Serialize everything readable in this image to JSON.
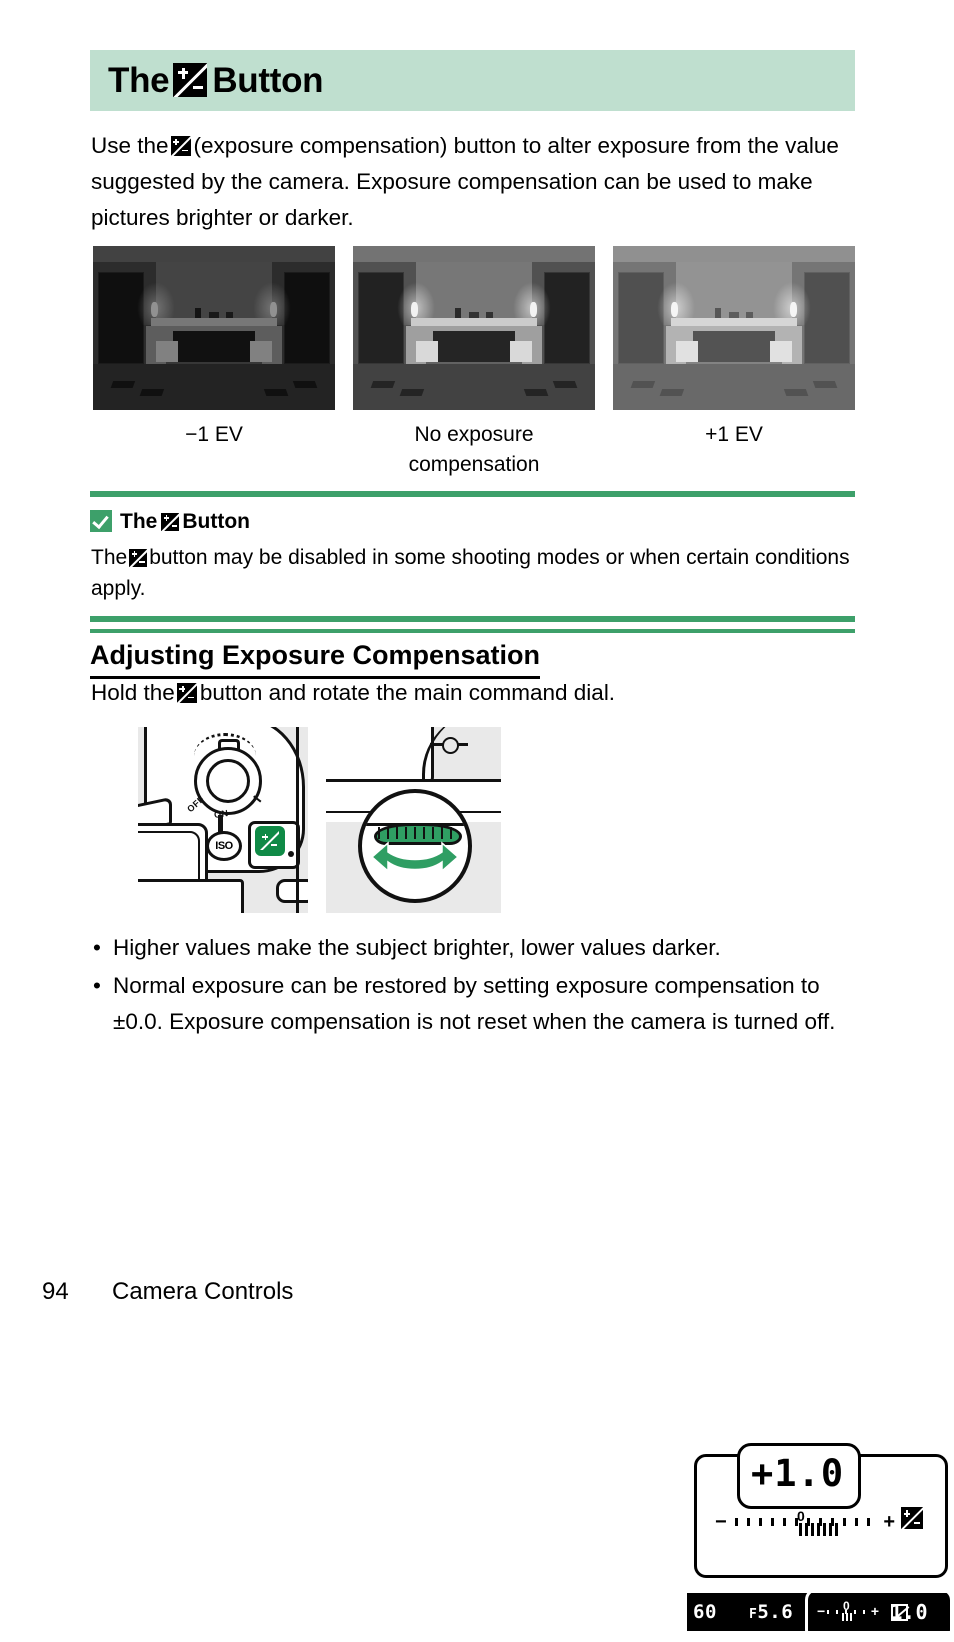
{
  "header": {
    "title_before": "The",
    "title_after": "Button",
    "icon": "exposure-compensation-icon",
    "band_color": "#bfdfcf"
  },
  "intro": {
    "part1": "Use the",
    "part2": "(exposure compensation) button to alter exposure from the value suggested by the camera. Exposure compensation can be used to make pictures brighter or darker."
  },
  "examples": [
    {
      "caption": "−1 EV",
      "name": "photo-minus-1ev"
    },
    {
      "caption": "No exposure compensation",
      "name": "photo-no-compensation"
    },
    {
      "caption": "+1 EV",
      "name": "photo-plus-1ev"
    }
  ],
  "note": {
    "icon": "check-mark-icon",
    "title_before": "The",
    "title_after": "Button",
    "body_part1": "The",
    "body_part2": "button may be disabled in some shooting modes or when certain conditions apply.",
    "rule_color": "#3da06a"
  },
  "section": {
    "heading": "Adjusting Exposure Compensation",
    "lead_part1": "Hold the",
    "lead_part2": "button and rotate the main command dial."
  },
  "figures": {
    "camera_top": {
      "name": "camera-top-illustration",
      "power_off": "OFF",
      "power_on": "ON",
      "iso_label": "ISO"
    },
    "command_dial": {
      "name": "command-dial-illustration"
    },
    "control_panel": {
      "name": "control-panel-display",
      "value": "+1.0",
      "scale_minus": "−",
      "scale_plus": "+",
      "scale_zero": "0",
      "icon": "exposure-compensation-icon"
    },
    "viewfinder": {
      "name": "viewfinder-display",
      "shutter_speed": "60",
      "aperture_prefix": "F",
      "aperture": "5.6",
      "scale_minus": "−",
      "scale_plus": "+",
      "scale_zero": "0",
      "icon": "exposure-compensation-icon",
      "value": "1.0"
    }
  },
  "bullets": [
    "Higher values make the subject brighter, lower values darker.",
    "Normal exposure can be restored by setting exposure compensation to ±0.0. Exposure compensation is not reset when the camera is turned off."
  ],
  "footer": {
    "page_number": "94",
    "section_name": "Camera Controls"
  }
}
